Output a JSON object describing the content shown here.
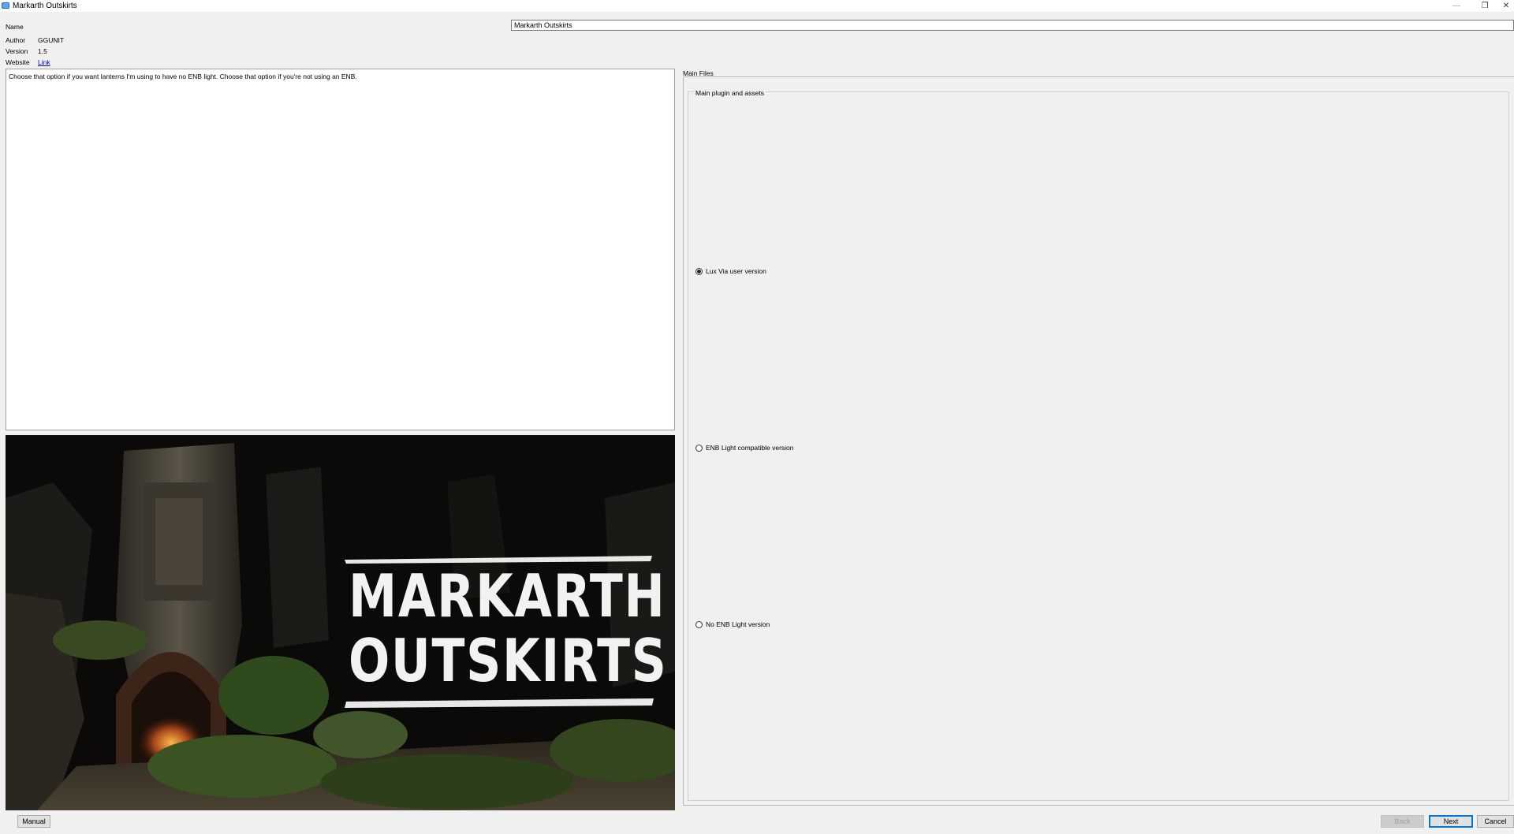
{
  "window": {
    "title": "Markarth Outskirts",
    "minimize_glyph": "—",
    "restore_glyph": "❐",
    "close_glyph": "✕"
  },
  "info": {
    "name_label": "Name",
    "name_value": "Markarth Outskirts",
    "author_label": "Author",
    "author_value": "GGUNIT",
    "version_label": "Version",
    "version_value": "1.5",
    "website_label": "Website",
    "website_link": "Link"
  },
  "description": "Choose that option if you want lanterns I'm using to have no ENB light. Choose that option if you're not using an ENB.",
  "preview": {
    "line1": "MARKARTH",
    "line2": "OUTSKIRTS"
  },
  "step": {
    "title": "Main Files",
    "group_title": "Main plugin and assets",
    "options": [
      {
        "label": "Lux Via user version",
        "selected": true
      },
      {
        "label": "ENB Light compatible version",
        "selected": false
      },
      {
        "label": "No ENB Light version",
        "selected": false
      }
    ]
  },
  "buttons": {
    "manual": "Manual",
    "back": "Back",
    "next": "Next",
    "cancel": "Cancel"
  }
}
